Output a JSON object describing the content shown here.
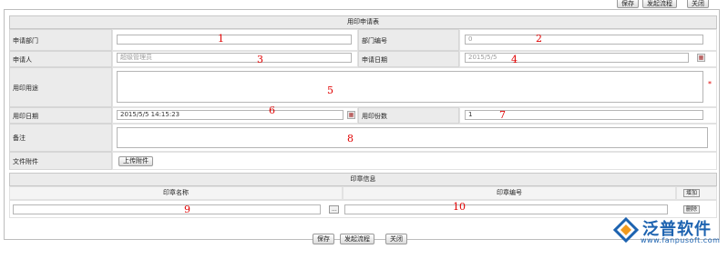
{
  "top_toolbar": {
    "save": "保存",
    "start_flow": "发起流程",
    "close": "关闭"
  },
  "form": {
    "title": "用印申请表",
    "apply_dept_label": "申请部门",
    "apply_dept_value": "",
    "dept_no_label": "部门编号",
    "dept_no_value": "0",
    "applicant_label": "申请人",
    "applicant_value": "超级管理员",
    "apply_date_label": "申请日期",
    "apply_date_value": "2015/5/5",
    "purpose_label": "用印用途",
    "required_mark": "*",
    "use_date_label": "用印日期",
    "use_date_value": "2015/5/5 14:15:23",
    "copies_label": "用印份数",
    "copies_value": "1",
    "remark_label": "备注",
    "attachment_label": "文件附件",
    "upload_button": "上传附件",
    "calendar_glyph": "▦"
  },
  "seal_section": {
    "title": "印章信息",
    "col_name": "印章名称",
    "col_no": "印章编号",
    "add_button": "增加",
    "delete_button": "删除",
    "browse_button": "..."
  },
  "annotations": [
    "1",
    "2",
    "3",
    "4",
    "5",
    "6",
    "7",
    "8",
    "9",
    "10"
  ],
  "bottom_toolbar": {
    "save": "保存",
    "start_flow": "发起流程",
    "close": "关闭"
  },
  "logo": {
    "name": "泛普软件",
    "url": "www.fanpusoft.com"
  },
  "colors": {
    "annotation": "#e00000",
    "brand_blue": "#1d63b0",
    "brand_orange": "#f29a1d"
  }
}
